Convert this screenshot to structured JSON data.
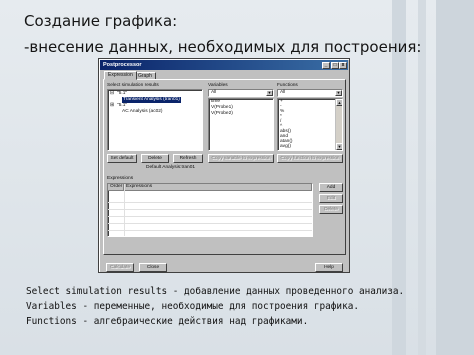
{
  "slide": {
    "heading_line1": "Создание графика:",
    "heading_line2": "-внесение данных, необходимых для построения:",
    "caption_line1": "Select simulation results - добавление данных проведенного анализа.",
    "caption_line2": "Variables - переменные, необходимые для построения графика.",
    "caption_line3": "Functions - алгебраические действия над графиками."
  },
  "window": {
    "title": "Postprocessor",
    "controls": {
      "minimize": "_",
      "maximize": "□",
      "close": "x"
    },
    "tabs": [
      {
        "label": "Expression",
        "active": true
      },
      {
        "label": "Graph",
        "active": false
      }
    ],
    "sim_results": {
      "label": "Select simulation results",
      "tree": [
        "\"5.1\"",
        "Transient Analysis (tran01)",
        "\"5.1\"",
        "AC Analysis (ac02)"
      ],
      "tree_toggles": [
        "⊟",
        "⊞"
      ],
      "selected_index": 1
    },
    "variables": {
      "label": "Variables",
      "filter": "All",
      "items": [
        "time",
        "V(Probe1)",
        "V(Probe2)"
      ]
    },
    "functions": {
      "label": "Functions",
      "filter": "All",
      "items": [
        "+",
        "-",
        "%",
        "*",
        "/",
        "^",
        "abs()",
        "and",
        "atan()",
        "avg()"
      ]
    },
    "buttons": {
      "set_default": "Set default",
      "delete": "Delete",
      "refresh": "Refresh",
      "copy_variable": "Copy variable to expression",
      "copy_function": "Copy function to expression",
      "add": "Add",
      "edit": "Edit",
      "delete_expr": "Delete",
      "calculate": "Calculate",
      "close": "Close",
      "help": "Help"
    },
    "default_analysis": "Default Analysis:tran01",
    "expressions": {
      "label": "Expressions",
      "columns": [
        "Order",
        "Expressions"
      ]
    }
  },
  "colors": {
    "title_bar": "#0a246a",
    "selection": "#0a246a",
    "face": "#c0c0c0"
  },
  "icons": {
    "scroll_up": "▲",
    "scroll_down": "▼",
    "dropdown": "▼"
  }
}
